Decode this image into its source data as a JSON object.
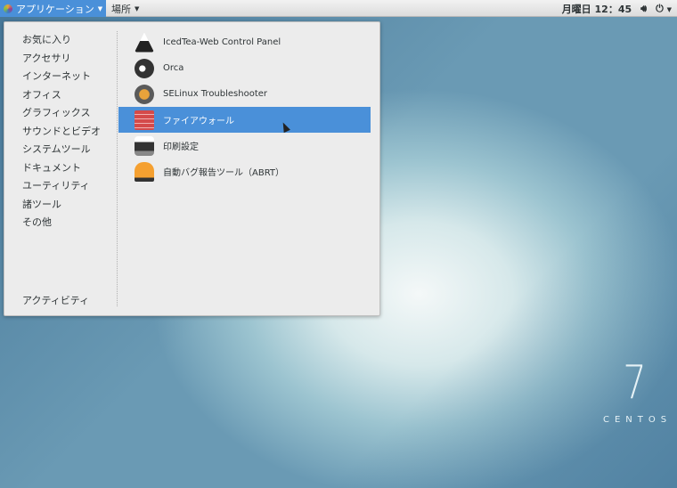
{
  "topbar": {
    "applications": "アプリケーション",
    "places": "場所",
    "clock": "月曜日 12：45",
    "volume_icon": "volume-icon",
    "power_icon": "power-icon"
  },
  "menu": {
    "categories": [
      "お気に入り",
      "アクセサリ",
      "インターネット",
      "オフィス",
      "グラフィックス",
      "サウンドとビデオ",
      "システムツール",
      "ドキュメント",
      "ユーティリティ",
      "諸ツール",
      "その他"
    ],
    "activities": "アクティビティ",
    "apps": [
      {
        "label": "IcedTea-Web Control Panel",
        "icon": "java-duke-icon",
        "color": "#222222"
      },
      {
        "label": "Orca",
        "icon": "orca-icon",
        "color": "#333333"
      },
      {
        "label": "SELinux Troubleshooter",
        "icon": "selinux-icon",
        "color": "#8a6a3a"
      },
      {
        "label": "ファイアウォール",
        "icon": "firewall-icon",
        "color": "#d44a4a"
      },
      {
        "label": "印刷設定",
        "icon": "printer-icon",
        "color": "#444444"
      },
      {
        "label": "自動バグ報告ツール（ABRT）",
        "icon": "abrt-alarm-icon",
        "color": "#e8731a"
      }
    ],
    "selected_index": 3
  },
  "desktop": {
    "version": "7",
    "brand": "CENTOS"
  },
  "colors": {
    "accent": "#4a90d9"
  }
}
